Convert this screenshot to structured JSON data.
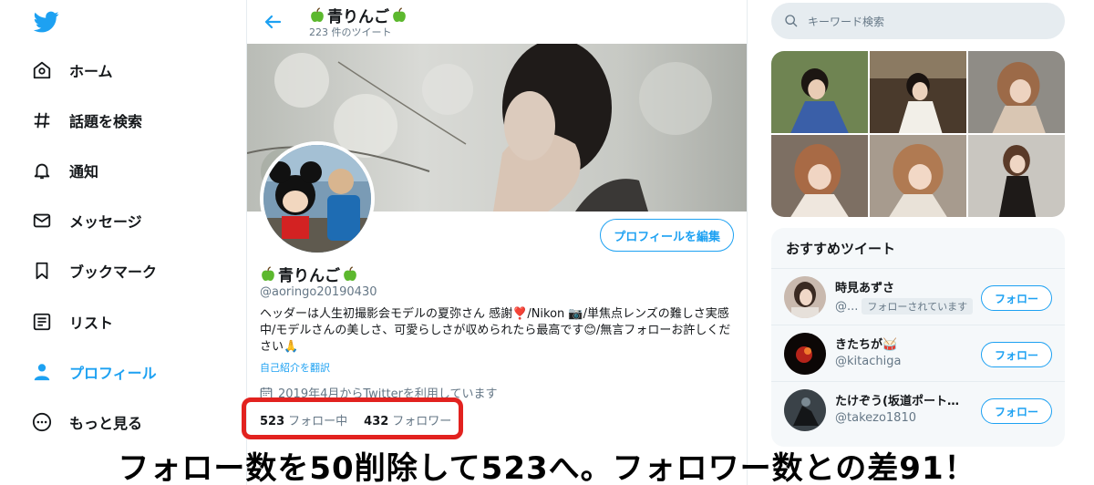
{
  "nav": {
    "items": [
      {
        "label": "ホーム",
        "icon": "home-icon"
      },
      {
        "label": "話題を検索",
        "icon": "hashtag-icon"
      },
      {
        "label": "通知",
        "icon": "bell-icon"
      },
      {
        "label": "メッセージ",
        "icon": "mail-icon"
      },
      {
        "label": "ブックマーク",
        "icon": "bookmark-icon"
      },
      {
        "label": "リスト",
        "icon": "list-icon"
      },
      {
        "label": "プロフィール",
        "icon": "person-icon",
        "active": true
      },
      {
        "label": "もっと見る",
        "icon": "more-icon"
      }
    ]
  },
  "header": {
    "name": "青りんご",
    "tweet_count": "223 件のツイート"
  },
  "profile": {
    "edit_label": "プロフィールを編集",
    "name": "青りんご",
    "handle": "@aoringo20190430",
    "bio_line1": "ヘッダーは人生初撮影会モデルの夏弥さん 感謝❣️/Nikon 📷/単焦点レンズの難しさ実感",
    "bio_line2": "中/モデルさんの美しさ、可愛らしさが収められたら最高です😊/無言フォローお許しくだ",
    "bio_line3": "さい🙏",
    "translate": "自己紹介を翻訳",
    "joined": "2019年4月からTwitterを利用しています",
    "following_count": "523",
    "following_label": "フォロー中",
    "followers_count": "432",
    "followers_label": "フォロワー"
  },
  "search": {
    "placeholder": "キーワード検索"
  },
  "suggest": {
    "title": "おすすめツイート",
    "follow_label": "フォロー",
    "users": [
      {
        "name": "時見あずさ",
        "handle": "@...",
        "badge": "フォローされています"
      },
      {
        "name": "きたちが🥁",
        "handle": "@kitachiga",
        "badge": ""
      },
      {
        "name": "たけぞう(坂道ポートレ...",
        "handle": "@takezo1810",
        "badge": ""
      }
    ]
  },
  "caption": "フォロー数を50削除して523へ。フォロワー数との差91！",
  "colors": {
    "accent": "#1da1f2",
    "highlight": "#e2221f"
  }
}
